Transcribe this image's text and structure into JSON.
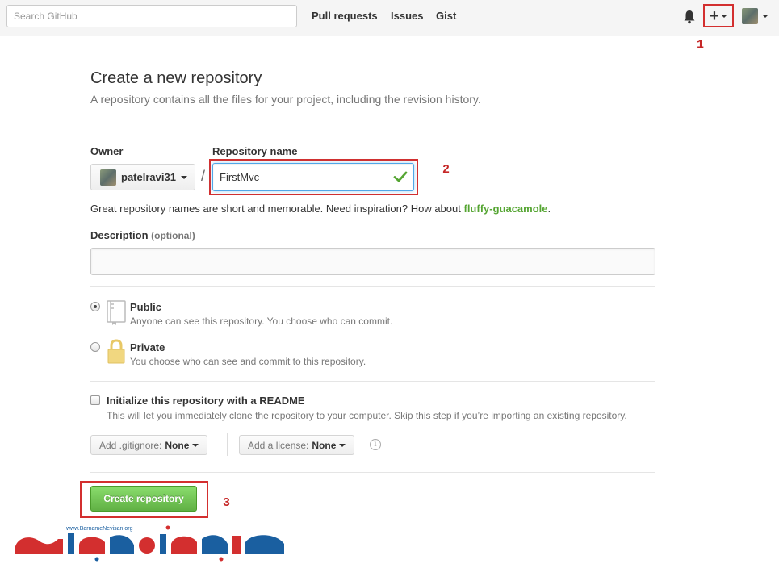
{
  "header": {
    "search_placeholder": "Search GitHub",
    "nav": [
      "Pull requests",
      "Issues",
      "Gist"
    ],
    "icons": [
      "bell-icon",
      "plus-icon",
      "avatar"
    ]
  },
  "annotations": {
    "step1": "1",
    "step2": "2",
    "step3": "3"
  },
  "page": {
    "title": "Create a new repository",
    "subtitle": "A repository contains all the files for your project, including the revision history."
  },
  "form": {
    "owner_label": "Owner",
    "owner_value": "patelravi31",
    "slash": "/",
    "repo_label": "Repository name",
    "repo_value": "FirstMvc",
    "hint_prefix": "Great repository names are short and memorable. Need inspiration? How about",
    "hint_suggestion": "fluffy-guacamole",
    "hint_suffix": ".",
    "description_label": "Description",
    "description_optional": "(optional)",
    "description_value": "",
    "public_title": "Public",
    "public_desc": "Anyone can see this repository. You choose who can commit.",
    "private_title": "Private",
    "private_desc": "You choose who can see and commit to this repository.",
    "readme_title": "Initialize this repository with a README",
    "readme_desc": "This will let you immediately clone the repository to your computer. Skip this step if you’re importing an existing repository.",
    "gitignore_label": "Add .gitignore:",
    "gitignore_value": "None",
    "license_label": "Add a license:",
    "license_value": "None",
    "create_button": "Create repository"
  },
  "watermark": {
    "url": "www.BarnameNevisan.org"
  },
  "colors": {
    "accent_red": "#d32f2f",
    "green": "#60b044",
    "suggestion_green": "#55a532",
    "focus_blue": "#51a7e8"
  }
}
